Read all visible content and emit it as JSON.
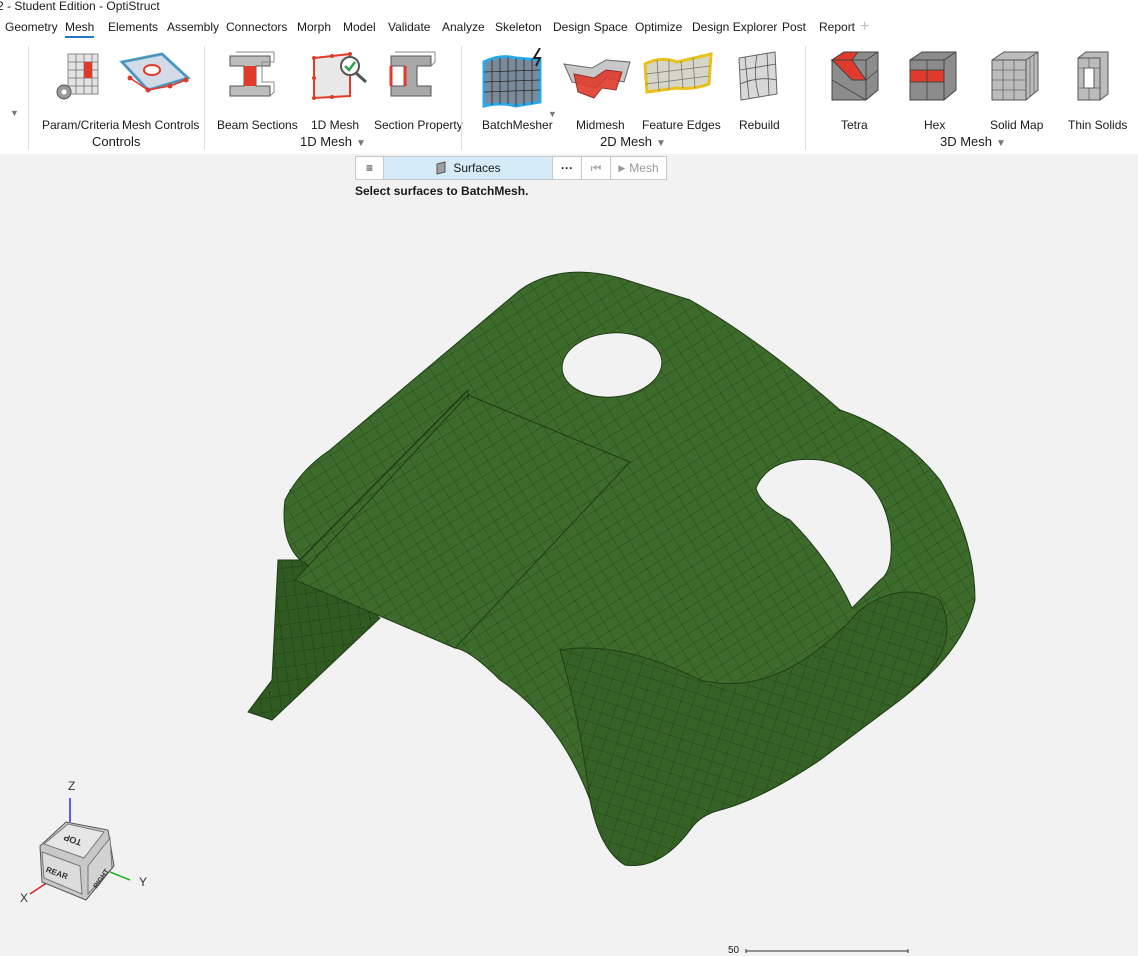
{
  "window": {
    "title": "2 - Student Edition - OptiStruct"
  },
  "menu": {
    "items": [
      "Geometry",
      "Mesh",
      "Elements",
      "Assembly",
      "Connectors",
      "Morph",
      "Model",
      "Validate",
      "Analyze",
      "Skeleton",
      "Design Space",
      "Optimize",
      "Design Explorer",
      "Post",
      "Report"
    ],
    "active": "Mesh"
  },
  "ribbon": {
    "tools": {
      "param_criteria": "Param/Criteria",
      "mesh_controls": "Mesh Controls",
      "beam_sections": "Beam Sections",
      "mesh_1d": "1D Mesh",
      "section_property": "Section Property",
      "batchmesher": "BatchMesher",
      "midmesh": "Midmesh",
      "feature_edges": "Feature Edges",
      "rebuild": "Rebuild",
      "tetra": "Tetra",
      "hex": "Hex",
      "solid_map": "Solid Map",
      "thin_solids": "Thin Solids"
    },
    "groups": {
      "controls": "Controls",
      "mesh_1d": "1D Mesh",
      "mesh_2d": "2D Mesh",
      "mesh_3d": "3D Mesh"
    }
  },
  "context_bar": {
    "menu_icon": "hamburger-icon",
    "selector": "Surfaces",
    "more": "···",
    "first": "⏮",
    "action": "Mesh"
  },
  "status": {
    "prompt": "Select surfaces to BatchMesh."
  },
  "viewcube": {
    "z": "Z",
    "y": "Y",
    "x": "X",
    "top": "TOP",
    "rear": "REAR",
    "right": "RIGHT"
  },
  "scale": {
    "label": "50"
  },
  "colors": {
    "mesh": "#3d6b2c",
    "mesh_lines": "#1f3d15",
    "accent": "#1e7ac8",
    "highlight": "#e03a2a"
  }
}
